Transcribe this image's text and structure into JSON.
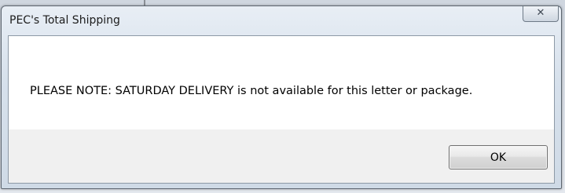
{
  "dialog": {
    "title": "PEC's Total Shipping",
    "close_glyph": "✕",
    "message": "PLEASE NOTE:  SATURDAY DELIVERY is not available for this letter or package.",
    "ok_label": "OK"
  },
  "icons": {
    "close": "close-icon"
  },
  "colors": {
    "titlebar": "#d7e1ec",
    "content_bg": "#ffffff",
    "button_area_bg": "#f0f0f0"
  }
}
